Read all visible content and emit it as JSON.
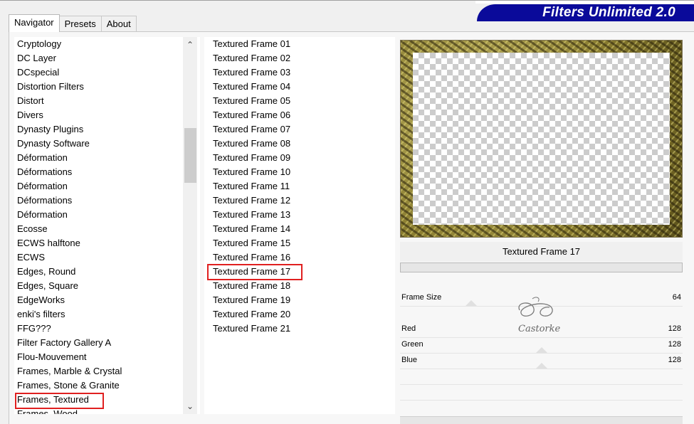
{
  "brand_title": "Filters Unlimited 2.0",
  "tabs": [
    {
      "label": "Navigator",
      "active": true
    },
    {
      "label": "Presets",
      "active": false
    },
    {
      "label": "About",
      "active": false
    }
  ],
  "categories": [
    "Cryptology",
    "DC Layer",
    "DCspecial",
    "Distortion Filters",
    "Distort",
    "Divers",
    "Dynasty Plugins",
    "Dynasty Software",
    "Déformation",
    "Déformations",
    "Déformation",
    "Déformations",
    "Déformation",
    "Ecosse",
    "ECWS halftone",
    "ECWS",
    "Edges, Round",
    "Edges, Square",
    "EdgeWorks",
    "enki's filters",
    "FFG???",
    "Filter Factory Gallery A",
    "Flou-Mouvement",
    "Frames, Marble & Crystal",
    "Frames, Stone & Granite",
    "Frames, Textured",
    "Frames, Wood"
  ],
  "selected_category": "Frames, Textured",
  "filters": [
    "Textured Frame 01",
    "Textured Frame 02",
    "Textured Frame 03",
    "Textured Frame 04",
    "Textured Frame 05",
    "Textured Frame 06",
    "Textured Frame 07",
    "Textured Frame 08",
    "Textured Frame 09",
    "Textured Frame 10",
    "Textured Frame 11",
    "Textured Frame 12",
    "Textured Frame 13",
    "Textured Frame 14",
    "Textured Frame 15",
    "Textured Frame 16",
    "Textured Frame 17",
    "Textured Frame 18",
    "Textured Frame 19",
    "Textured Frame 20",
    "Textured Frame 21"
  ],
  "selected_filter": "Textured Frame 17",
  "params": [
    {
      "label": "Frame Size",
      "value": "64"
    },
    {
      "label": "Red",
      "value": "128"
    },
    {
      "label": "Green",
      "value": "128"
    },
    {
      "label": "Blue",
      "value": "128"
    }
  ],
  "watermark_text": "Castorke",
  "colors": {
    "brand_bg": "#0a0a9a",
    "highlight": "#e02020"
  }
}
